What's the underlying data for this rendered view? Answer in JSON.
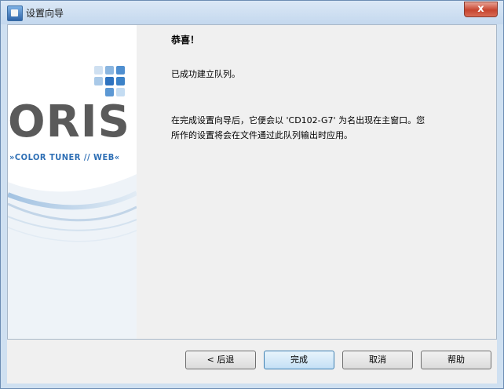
{
  "window": {
    "title": "设置向导",
    "close_label": "x"
  },
  "side_panel": {
    "brand": "ORIS",
    "tagline": "»COLOR TUNER // WEB«"
  },
  "content": {
    "heading": "恭喜！",
    "message_1": "已成功建立队列。",
    "message_2": "在完成设置向导后，它便会以 'CD102-G7' 为名出现在主窗口。您所作的设置将会在文件通过此队列输出时应用。"
  },
  "buttons": {
    "back": "< 后退",
    "finish": "完成",
    "cancel": "取消",
    "help": "帮助"
  }
}
